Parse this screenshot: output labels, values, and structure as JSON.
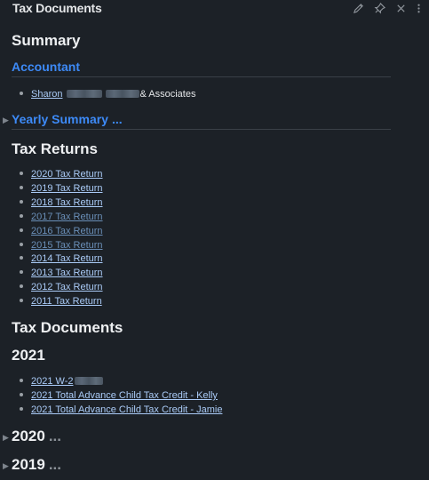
{
  "window": {
    "title": "Tax Documents"
  },
  "toolbar": {
    "icons": [
      "edit-icon",
      "pin-icon",
      "close-icon",
      "more-icon"
    ]
  },
  "summary": {
    "heading": "Summary",
    "accountant": {
      "heading": "Accountant",
      "item": {
        "name": "Sharon",
        "suffix": "& Associates"
      }
    },
    "yearly_summary": {
      "heading": "Yearly Summary",
      "collapsed_marker": "..."
    }
  },
  "tax_returns": {
    "heading": "Tax Returns",
    "items": [
      {
        "label": "2020 Tax Return",
        "visited": false
      },
      {
        "label": "2019 Tax Return",
        "visited": false
      },
      {
        "label": "2018 Tax Return",
        "visited": false
      },
      {
        "label": "2017 Tax Return",
        "visited": true
      },
      {
        "label": "2016 Tax Return",
        "visited": true
      },
      {
        "label": "2015 Tax Return",
        "visited": true
      },
      {
        "label": "2014 Tax Return",
        "visited": false
      },
      {
        "label": "2013 Tax Return",
        "visited": false
      },
      {
        "label": "2012 Tax Return",
        "visited": false
      },
      {
        "label": "2011 Tax Return",
        "visited": false
      }
    ]
  },
  "tax_documents": {
    "heading": "Tax Documents",
    "year_2021": {
      "heading": "2021",
      "items": [
        {
          "label": "2021 W-2"
        },
        {
          "label": "2021 Total Advance Child Tax Credit - Kelly"
        },
        {
          "label": "2021 Total Advance Child Tax Credit - Jamie"
        }
      ]
    },
    "year_2020": {
      "heading": "2020",
      "collapsed_marker": "..."
    },
    "year_2019": {
      "heading": "2019",
      "collapsed_marker": "..."
    }
  },
  "colors": {
    "background": "#1c2127",
    "heading_blue": "#3d8af7",
    "link": "#aacbf7",
    "link_visited": "#6a8fb8"
  }
}
